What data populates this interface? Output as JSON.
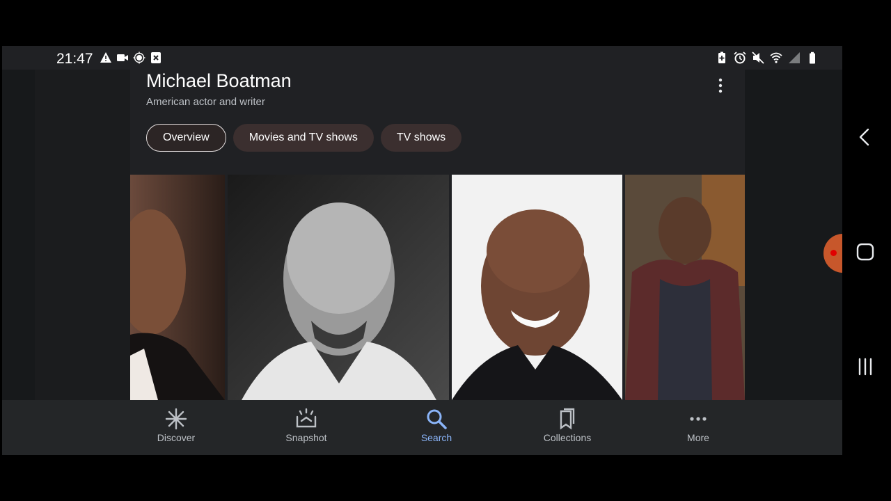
{
  "status_bar": {
    "time": "21:47",
    "left_icons": [
      "warning-icon",
      "video-camera-icon",
      "location-icon",
      "close-box-icon"
    ],
    "right_icons": [
      "battery-saver-icon",
      "alarm-icon",
      "mute-icon",
      "wifi-icon",
      "signal-icon",
      "battery-icon"
    ]
  },
  "knowledge_panel": {
    "title": "Michael Boatman",
    "subtitle": "American actor and writer",
    "tabs": [
      {
        "label": "Overview",
        "active": true
      },
      {
        "label": "Movies and TV shows",
        "active": false
      },
      {
        "label": "TV shows",
        "active": false
      }
    ],
    "photos": [
      "photo-1",
      "photo-2",
      "photo-3",
      "photo-4"
    ]
  },
  "bottom_nav": {
    "items": [
      {
        "label": "Discover",
        "icon": "asterisk-icon"
      },
      {
        "label": "Snapshot",
        "icon": "snapshot-icon"
      },
      {
        "label": "Search",
        "icon": "search-icon",
        "active": true
      },
      {
        "label": "Collections",
        "icon": "collections-icon"
      },
      {
        "label": "More",
        "icon": "more-horizontal-icon"
      }
    ]
  },
  "colors": {
    "active_nav": "#8ab4f8",
    "chip_bg": "#3b2f2f",
    "card_bg": "#202124"
  }
}
